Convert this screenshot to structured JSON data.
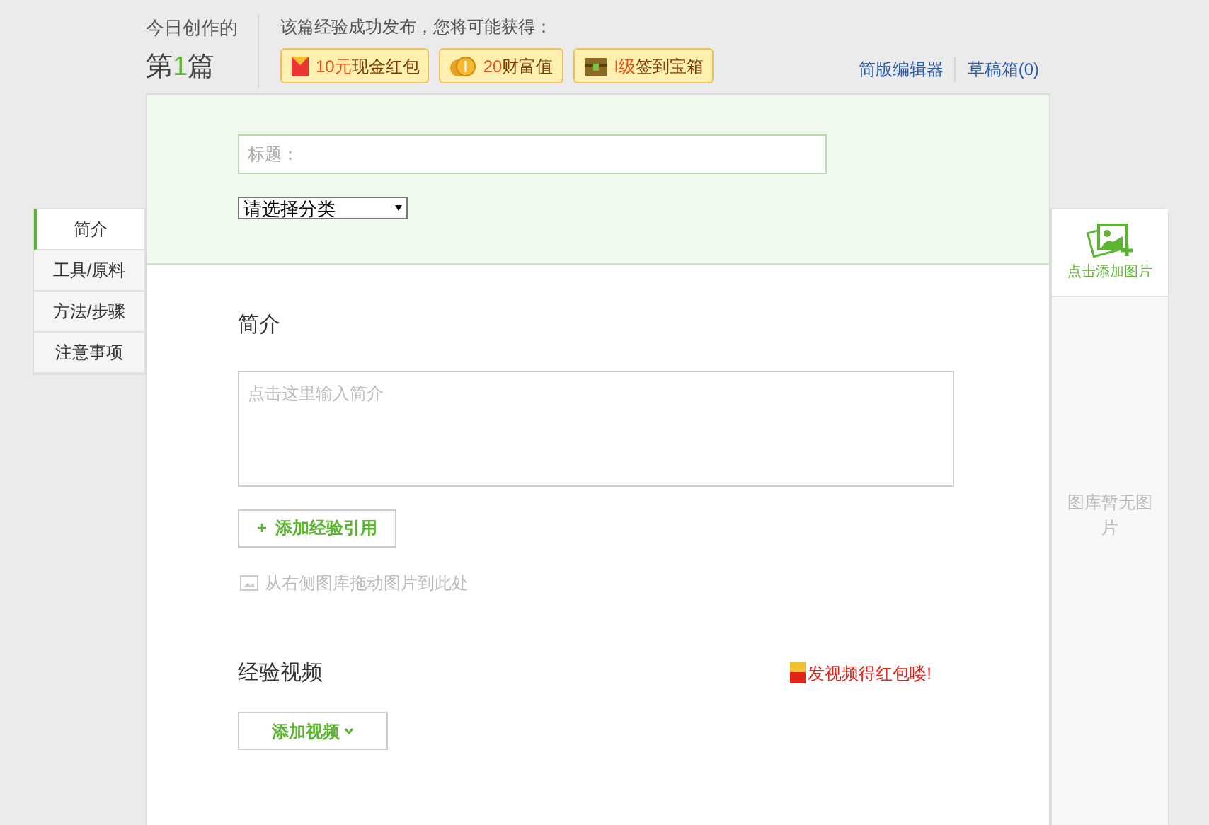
{
  "header": {
    "today_label": "今日创作的",
    "count_prefix": "第",
    "count": "1",
    "count_suffix": "篇",
    "rewards_intro": "该篇经验成功发布，您将可能获得：",
    "rewards": [
      {
        "kind": "redpacket",
        "amount": "10元",
        "label": "现金红包"
      },
      {
        "kind": "coin",
        "amount": "20",
        "label": "财富值"
      },
      {
        "kind": "chest",
        "amount": "I级",
        "label": "签到宝箱"
      }
    ],
    "links": [
      "简版编辑器",
      "草稿箱(0)"
    ]
  },
  "form": {
    "title_placeholder": "标题：",
    "category": "请选择分类"
  },
  "nav": [
    {
      "label": "简介",
      "selected": true
    },
    {
      "label": "工具/原料",
      "selected": false
    },
    {
      "label": "方法/步骤",
      "selected": false
    },
    {
      "label": "注意事项",
      "selected": false
    }
  ],
  "intro": {
    "heading": "简介",
    "placeholder": "点击这里输入简介",
    "plus": "+",
    "add_reference": "添加经验引用",
    "drag_hint": "从右侧图库拖动图片到此处"
  },
  "video": {
    "heading": "经验视频",
    "promo": "发视频得红包喽!",
    "add_video": "添加视频"
  },
  "gallery": {
    "add_image": "点击添加图片",
    "empty": "图库暂无图片"
  }
}
